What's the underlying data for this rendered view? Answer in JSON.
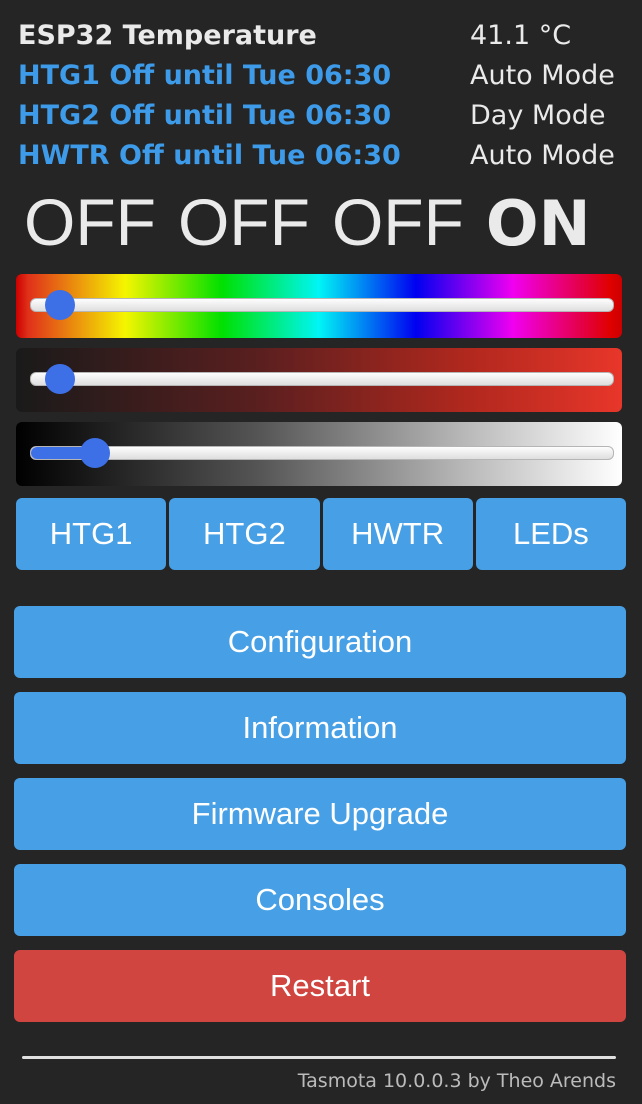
{
  "sensors": [
    {
      "label": "ESP32 Temperature",
      "value": "41.1 °C",
      "color": "#eaeaea"
    },
    {
      "label": "HTG1 Off until Tue 06:30",
      "value": "Auto Mode",
      "color": "#3d9be9"
    },
    {
      "label": "HTG2 Off until Tue 06:30",
      "value": "Day Mode",
      "color": "#3d9be9"
    },
    {
      "label": "HWTR Off until Tue 06:30",
      "value": "Auto Mode",
      "color": "#3d9be9"
    }
  ],
  "power_states": [
    "OFF",
    "OFF",
    "OFF",
    "ON"
  ],
  "sliders": {
    "hue": {
      "percent": 5
    },
    "saturation": {
      "percent": 5
    },
    "brightness": {
      "percent": 11
    }
  },
  "toggles": [
    "HTG1",
    "HTG2",
    "HWTR",
    "LEDs"
  ],
  "menu": {
    "configuration": "Configuration",
    "information": "Information",
    "firmware_upgrade": "Firmware Upgrade",
    "consoles": "Consoles",
    "restart": "Restart"
  },
  "footer": "Tasmota 10.0.0.3 by Theo Arends",
  "colors": {
    "background": "#252525",
    "button": "#47a0e6",
    "danger": "#d04540",
    "accent_text": "#3d9be9",
    "slider_thumb": "#3d6fe6"
  }
}
